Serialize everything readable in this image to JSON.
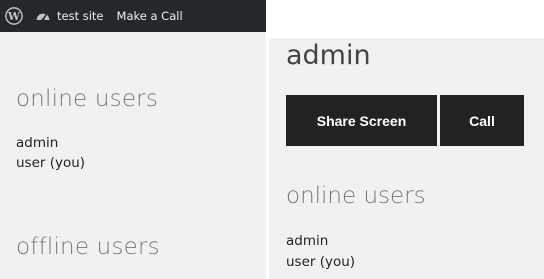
{
  "adminbar": {
    "logo_icon": "wordpress-logo-icon",
    "site_icon": "dashboard-icon",
    "site_name": "test site",
    "make_call": "Make a Call"
  },
  "left_panel": {
    "online_heading": "online users",
    "online_users": [
      "admin",
      "user (you)"
    ],
    "offline_heading": "offline users"
  },
  "right_panel": {
    "room_title": "admin",
    "share_screen_label": "Share Screen",
    "call_label": "Call",
    "online_heading": "online users",
    "online_users": [
      "admin",
      "user (you)"
    ]
  },
  "colors": {
    "adminbar_bg": "#23282d",
    "button_bg": "#222222",
    "panel_bg": "#f1f1f1"
  }
}
